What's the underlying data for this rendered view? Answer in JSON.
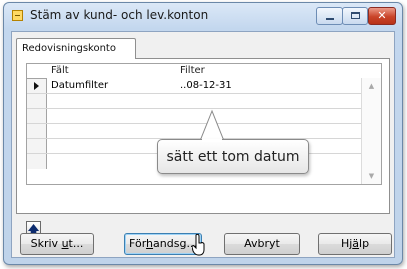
{
  "window": {
    "title": "Stäm av kund- och lev.konton",
    "controls": {
      "close_glyph": "✕"
    }
  },
  "tab": {
    "label": "Redovisningskonto"
  },
  "grid": {
    "columns": [
      "Fält",
      "Filter"
    ],
    "rows": [
      {
        "field": "Datumfilter",
        "filter": "..08-12-31",
        "selected": true
      },
      {
        "field": "",
        "filter": ""
      },
      {
        "field": "",
        "filter": ""
      },
      {
        "field": "",
        "filter": ""
      },
      {
        "field": "",
        "filter": ""
      },
      {
        "field": "",
        "filter": ""
      }
    ]
  },
  "callout": {
    "text": "sätt ett tom datum"
  },
  "up_button": {
    "glyph": "🡅",
    "icon": "arrow-up-icon"
  },
  "buttons": {
    "print": {
      "pre": "Skriv ",
      "accel": "u",
      "post": "t..."
    },
    "preview": {
      "pre": "För",
      "accel": "h",
      "post": "andsg..."
    },
    "cancel": {
      "label": "Avbryt"
    },
    "help": {
      "pre": "Hj",
      "accel": "ä",
      "post": "lp"
    }
  },
  "colors": {
    "title_bar": "#c3d7ee",
    "close_button": "#c94429",
    "focus_border": "#3c7fb1"
  }
}
